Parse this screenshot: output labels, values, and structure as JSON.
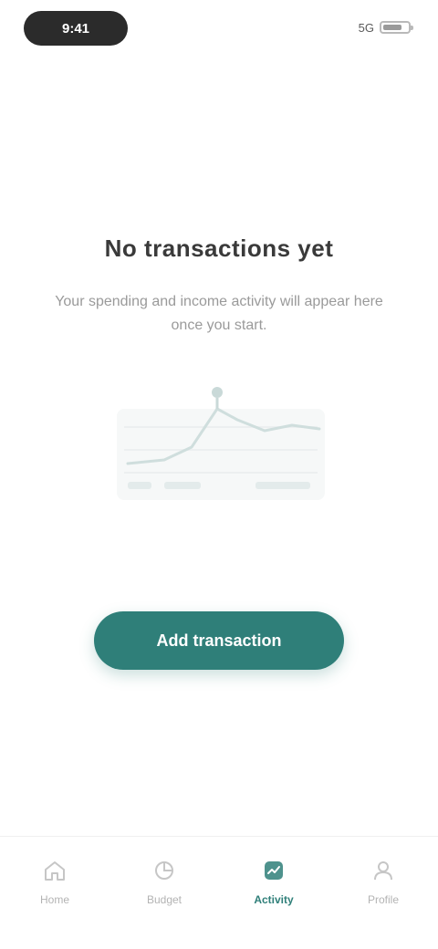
{
  "status_bar": {
    "time": "9:41",
    "signal": "5G",
    "battery_level": 0.75
  },
  "main": {
    "title": "No transactions yet",
    "subtitle": "Your spending and income activity will appear here once you start.",
    "cta_label": "Add transaction"
  },
  "bottom_nav": {
    "items": [
      {
        "label": "Home",
        "icon": "home-icon",
        "active": false
      },
      {
        "label": "Budget",
        "icon": "budget-icon",
        "active": false
      },
      {
        "label": "Activity",
        "icon": "activity-icon",
        "active": true
      },
      {
        "label": "Profile",
        "icon": "profile-icon",
        "active": false
      }
    ]
  },
  "colors": {
    "accent": "#2f7f79",
    "muted": "#b3b3b3",
    "text": "#3a3a3a"
  }
}
